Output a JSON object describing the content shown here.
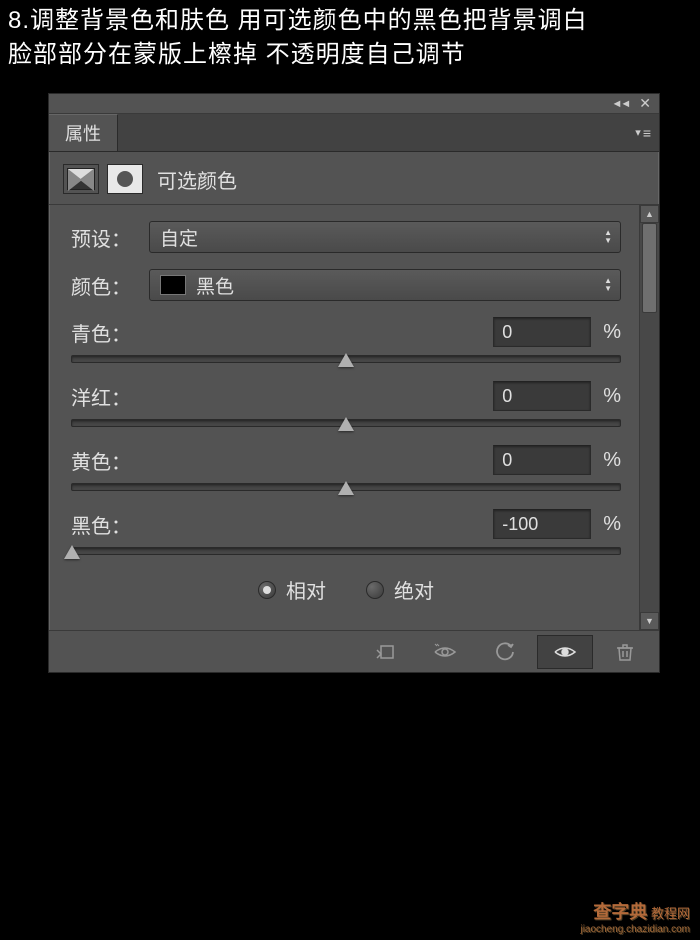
{
  "instruction": {
    "line1": "8.调整背景色和肤色   用可选颜色中的黑色把背景调白",
    "line2": "脸部部分在蒙版上檫掉  不透明度自己调节"
  },
  "panel": {
    "tab_label": "属性",
    "title": "可选颜色"
  },
  "preset": {
    "label": "预设：",
    "value": "自定"
  },
  "color": {
    "label": "颜色：",
    "value": "黑色"
  },
  "sliders": [
    {
      "label": "青色：",
      "value": "0",
      "thumb_pct": 50
    },
    {
      "label": "洋红：",
      "value": "0",
      "thumb_pct": 50
    },
    {
      "label": "黄色：",
      "value": "0",
      "thumb_pct": 50
    },
    {
      "label": "黑色：",
      "value": "-100",
      "thumb_pct": 0
    }
  ],
  "percent_sign": "%",
  "method": {
    "relative": "相对",
    "absolute": "绝对"
  },
  "watermark": {
    "main": "查字典",
    "sub": "教程网",
    "url": "jiaocheng.chazidian.com"
  }
}
